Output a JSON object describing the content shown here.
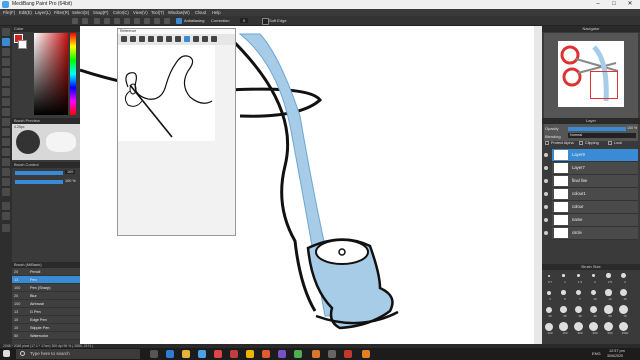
{
  "window": {
    "title": "MediBang Paint Pro (64bit)",
    "controls": [
      "–",
      "□",
      "✕"
    ]
  },
  "menu": [
    "File(F)",
    "Edit(E)",
    "Layer(L)",
    "Filter(R)",
    "Select(S)",
    "Snap(P)",
    "Color(C)",
    "View(V)",
    "Tool(T)",
    "Window(W)",
    "Cloud",
    "Help"
  ],
  "toolbar": {
    "antialiasing_label": "Antialiasing",
    "correction_label": "Correction",
    "correction_value": "0",
    "soft_edge_label": "Soft Edge"
  },
  "left_panel": {
    "color_title": "Color",
    "color_fg": "#cc2222",
    "brush_preview_title": "Brush Preview",
    "brush_size": "4.25px",
    "brush_control_title": "Brush Control",
    "size_value": "100",
    "opacity_value": "100 %",
    "brush_list_title": "Brush (MiBank)",
    "brushes": [
      {
        "size": "20",
        "name": "Pencil"
      },
      {
        "size": "13",
        "name": "Pen"
      },
      {
        "size": "100",
        "name": "Pen (Sharp)"
      },
      {
        "size": "20",
        "name": "Blur"
      },
      {
        "size": "100",
        "name": "Airbrush"
      },
      {
        "size": "13",
        "name": "G Pen"
      },
      {
        "size": "10",
        "name": "Edge Pen"
      },
      {
        "size": "10",
        "name": "Stipple Pen"
      },
      {
        "size": "50",
        "name": "Watercolor"
      }
    ]
  },
  "reference": {
    "title": "Reference"
  },
  "right_panel": {
    "navigator_title": "Navigator",
    "layer_title": "Layer",
    "opacity_label": "Opacity",
    "opacity_value": "100 %",
    "blending_label": "Blending",
    "blending_value": "Normal",
    "protect_alpha": "Protect Alpha",
    "clipping": "Clipping",
    "lock": "Lock",
    "layers": [
      "Layer9",
      "Layer7",
      "final line",
      "colour1",
      "colour",
      "name",
      "circle"
    ],
    "brush_size_title": "Brush Size",
    "brush_sizes": [
      "0.7",
      "1",
      "1.5",
      "2",
      "2.5",
      "3",
      "4",
      "5",
      "7",
      "10",
      "12",
      "15",
      "20",
      "25",
      "30",
      "40",
      "50",
      "70",
      "100",
      "150",
      "200",
      "300",
      "500",
      "1000"
    ]
  },
  "status": {
    "text": "2048 * 2048 pixel  (17.1 * 17cm)  300 dpi  96 %  ( 2655, 2574 )"
  },
  "taskbar": {
    "search_placeholder": "Type here to search",
    "language": "ENG",
    "time": "12:57 pm",
    "date": "30/6/2020"
  },
  "colors": {
    "accent": "#3a8bd6",
    "drawing_blue": "#a7cce8"
  }
}
